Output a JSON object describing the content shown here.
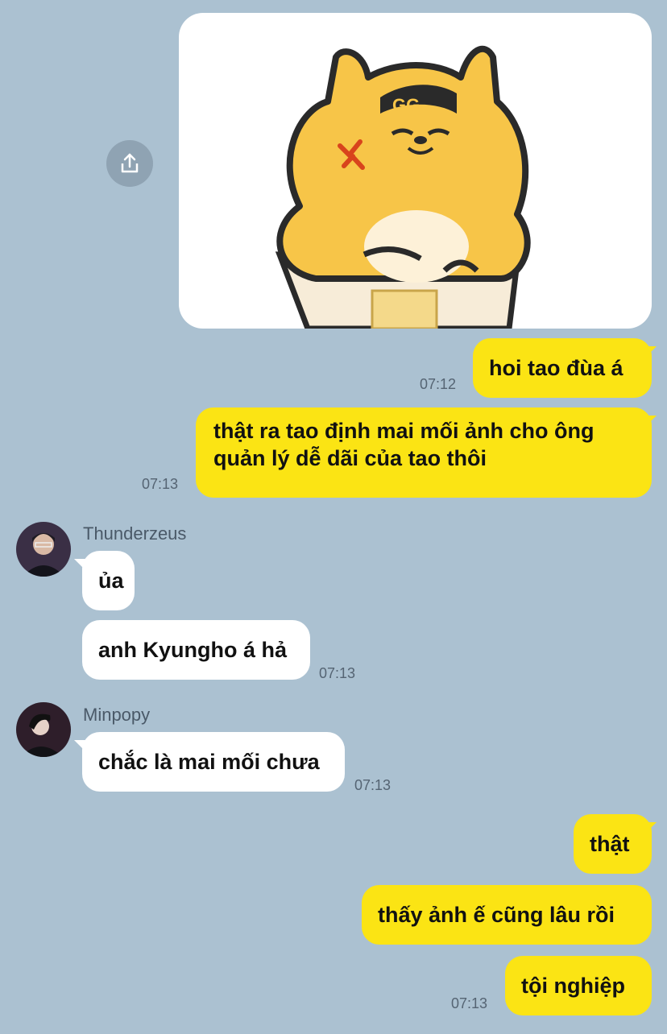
{
  "sticker": {
    "icon": "angry-shiba-sticker"
  },
  "share": {
    "icon": "share-icon"
  },
  "messages": [
    {
      "text": "hoi tao đùa á",
      "time": "07:12"
    },
    {
      "text": "thật ra tao định mai mối ảnh cho ông quản lý dễ dãi của tao thôi",
      "time": "07:13"
    },
    {
      "sender": "Thunderzeus",
      "text": "ủa"
    },
    {
      "text": "anh Kyungho á hả",
      "time": "07:13"
    },
    {
      "sender": "Minpopy",
      "text": "chắc là mai mối chưa",
      "time": "07:13"
    },
    {
      "text": "thật"
    },
    {
      "text": "thấy ảnh ế cũng lâu rồi"
    },
    {
      "text": "tội nghiệp",
      "time": "07:13"
    }
  ],
  "colors": {
    "background": "#abc1d1",
    "my_bubble": "#fbe414",
    "their_bubble": "#ffffff"
  }
}
